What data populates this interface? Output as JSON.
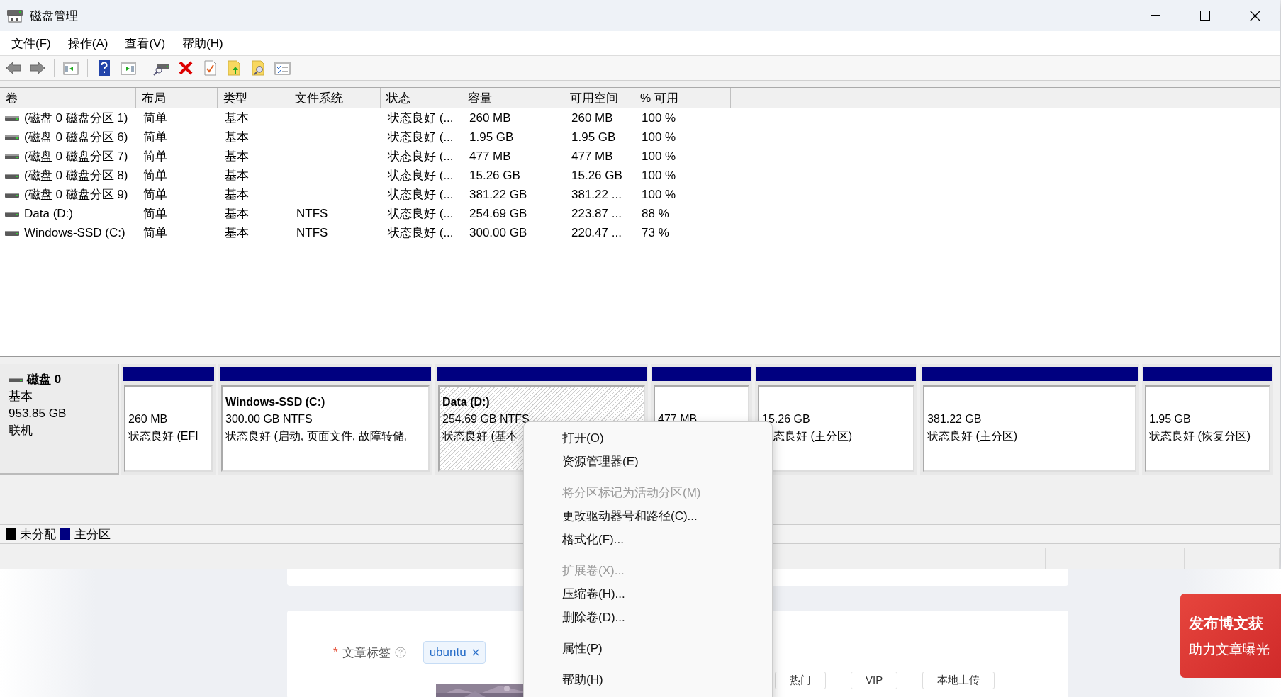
{
  "window": {
    "title": "磁盘管理"
  },
  "menu_bar": [
    "文件(F)",
    "操作(A)",
    "查看(V)",
    "帮助(H)"
  ],
  "volume_table": {
    "columns": [
      "卷",
      "布局",
      "类型",
      "文件系统",
      "状态",
      "容量",
      "可用空间",
      "% 可用"
    ],
    "rows": [
      {
        "volume": "(磁盘 0 磁盘分区 1)",
        "layout": "简单",
        "type": "基本",
        "status": "状态良好 (...",
        "capacity": "260 MB",
        "free": "260 MB",
        "percent_free": "100 %"
      },
      {
        "volume": "(磁盘 0 磁盘分区 6)",
        "layout": "简单",
        "type": "基本",
        "status": "状态良好 (...",
        "capacity": "1.95 GB",
        "free": "1.95 GB",
        "percent_free": "100 %"
      },
      {
        "volume": "(磁盘 0 磁盘分区 7)",
        "layout": "简单",
        "type": "基本",
        "status": "状态良好 (...",
        "capacity": "477 MB",
        "free": "477 MB",
        "percent_free": "100 %"
      },
      {
        "volume": "(磁盘 0 磁盘分区 8)",
        "layout": "简单",
        "type": "基本",
        "status": "状态良好 (...",
        "capacity": "15.26 GB",
        "free": "15.26 GB",
        "percent_free": "100 %"
      },
      {
        "volume": "(磁盘 0 磁盘分区 9)",
        "layout": "简单",
        "type": "基本",
        "status": "状态良好 (...",
        "capacity": "381.22 GB",
        "free": "381.22 ...",
        "percent_free": "100 %"
      },
      {
        "volume": "Data (D:)",
        "layout": "简单",
        "type": "基本",
        "file_system": "NTFS",
        "status": "状态良好 (...",
        "capacity": "254.69 GB",
        "free": "223.87 ...",
        "percent_free": "88 %"
      },
      {
        "volume": "Windows-SSD (C:)",
        "layout": "简单",
        "type": "基本",
        "file_system": "NTFS",
        "status": "状态良好 (...",
        "capacity": "300.00 GB",
        "free": "220.47 ...",
        "percent_free": "73 %"
      }
    ]
  },
  "disk": {
    "name": "磁盘 0",
    "type": "基本",
    "size": "953.85 GB",
    "status": "联机",
    "partitions": [
      {
        "color": "#000080",
        "selected": false,
        "size": "260 MB",
        "status": "状态良好 (EFI"
      },
      {
        "color": "#000080",
        "selected": false,
        "title": "Windows-SSD (C:)",
        "size": "300.00 GB NTFS",
        "status": "状态良好 (启动, 页面文件, 故障转储,"
      },
      {
        "color": "#000080",
        "selected": true,
        "title": "Data (D:)",
        "size": "254.69 GB NTFS",
        "status": "状态良好 (基本"
      },
      {
        "color": "#000080",
        "selected": false,
        "size": "477 MB"
      },
      {
        "color": "#000080",
        "selected": false,
        "size": "15.26 GB",
        "status": "态良好 (主分区)"
      },
      {
        "color": "#000080",
        "selected": false,
        "size": "381.22 GB",
        "status": "状态良好 (主分区)"
      },
      {
        "color": "#000080",
        "selected": false,
        "size": "1.95 GB",
        "status": "状态良好 (恢复分区)"
      }
    ]
  },
  "legend": [
    {
      "label": "未分配",
      "color": "#000000"
    },
    {
      "label": "主分区",
      "color": "#000080"
    }
  ],
  "context_menu": [
    {
      "kind": "item",
      "label": "打开(O)",
      "disabled": false
    },
    {
      "kind": "item",
      "label": "资源管理器(E)",
      "disabled": false
    },
    {
      "kind": "separator"
    },
    {
      "kind": "item",
      "label": "将分区标记为活动分区(M)",
      "disabled": true
    },
    {
      "kind": "item",
      "label": "更改驱动器号和路径(C)...",
      "disabled": false
    },
    {
      "kind": "item",
      "label": "格式化(F)...",
      "disabled": false
    },
    {
      "kind": "separator"
    },
    {
      "kind": "item",
      "label": "扩展卷(X)...",
      "disabled": true
    },
    {
      "kind": "item",
      "label": "压缩卷(H)...",
      "disabled": false
    },
    {
      "kind": "item",
      "label": "删除卷(D)...",
      "disabled": false
    },
    {
      "kind": "separator"
    },
    {
      "kind": "item",
      "label": "属性(P)",
      "disabled": false
    },
    {
      "kind": "separator"
    },
    {
      "kind": "item",
      "label": "帮助(H)",
      "disabled": false
    }
  ],
  "background_page": {
    "required_mark": "*",
    "tag_label": "文章标签",
    "tags": [
      "ubuntu"
    ],
    "buttons": [
      "热门",
      "VIP",
      "本地上传"
    ],
    "banner": {
      "title": "发布博文获",
      "subtitle": "助力文章曝光"
    }
  }
}
